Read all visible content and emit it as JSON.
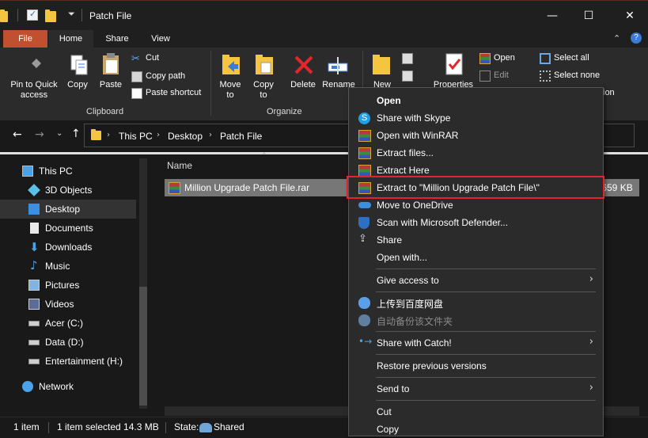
{
  "window": {
    "title": "Patch File",
    "minimize_icon": "minimize-icon",
    "maximize_icon": "maximize-icon",
    "close_icon": "close-icon",
    "min_glyph": "—",
    "max_glyph": "☐",
    "close_glyph": "✕"
  },
  "tabs": {
    "file": "File",
    "home": "Home",
    "share": "Share",
    "view": "View"
  },
  "ribbon": {
    "pin_label_1": "Pin to Quick",
    "pin_label_2": "access",
    "copy": "Copy",
    "paste": "Paste",
    "cut": "Cut",
    "copy_path": "Copy path",
    "paste_shortcut": "Paste shortcut",
    "clipboard_group": "Clipboard",
    "move_to": "Move",
    "move_to_2": "to",
    "copy_to": "Copy",
    "copy_to_2": "to",
    "delete": "Delete",
    "rename": "Rename",
    "organize_group": "Organize",
    "new": "New",
    "properties": "Properties",
    "open": "Open",
    "edit": "Edit",
    "select_all": "Select all",
    "select_none": "Select none",
    "invert_fragment": "ion"
  },
  "address": {
    "crumbs": [
      "This PC",
      "Desktop",
      "Patch File"
    ]
  },
  "nav": {
    "items": [
      {
        "label": "This PC",
        "icon": "pc-icon"
      },
      {
        "label": "3D Objects",
        "icon": "cube-icon"
      },
      {
        "label": "Desktop",
        "icon": "desktop-icon"
      },
      {
        "label": "Documents",
        "icon": "documents-icon"
      },
      {
        "label": "Downloads",
        "icon": "download-icon"
      },
      {
        "label": "Music",
        "icon": "music-icon"
      },
      {
        "label": "Pictures",
        "icon": "pictures-icon"
      },
      {
        "label": "Videos",
        "icon": "videos-icon"
      },
      {
        "label": "Acer (C:)",
        "icon": "drive-icon"
      },
      {
        "label": "Data (D:)",
        "icon": "drive-icon"
      },
      {
        "label": "Entertainment (H:)",
        "icon": "drive-icon"
      },
      {
        "label": "Network",
        "icon": "network-icon"
      }
    ]
  },
  "content": {
    "column_name": "Name",
    "file_name": "Million Upgrade Patch File.rar",
    "file_size": ",659 KB"
  },
  "status": {
    "item_count": "1 item",
    "selected": "1 item selected  14.3 MB",
    "state": "State:",
    "shared": "Shared"
  },
  "context_menu": {
    "items": [
      {
        "label": "Open",
        "icon": "none",
        "bold": true
      },
      {
        "label": "Share with Skype",
        "icon": "skype-icon"
      },
      {
        "label": "Open with WinRAR",
        "icon": "winrar-icon"
      },
      {
        "label": "Extract files...",
        "icon": "winrar-icon"
      },
      {
        "label": "Extract Here",
        "icon": "winrar-icon"
      },
      {
        "label": "Extract to \"Million Upgrade Patch File\\\"",
        "icon": "winrar-icon",
        "highlighted": true
      },
      {
        "label": "Move to OneDrive",
        "icon": "onedrive-icon"
      },
      {
        "label": "Scan with Microsoft Defender...",
        "icon": "defender-icon"
      },
      {
        "label": "Share",
        "icon": "share-icon"
      },
      {
        "label": "Open with...",
        "icon": "none"
      },
      {
        "label": "Give access to",
        "icon": "none",
        "submenu": true
      },
      {
        "label": "上传到百度网盘",
        "icon": "baidu-icon"
      },
      {
        "label": "自动备份该文件夹",
        "icon": "baidu-icon",
        "disabled": true
      },
      {
        "label": "Share with Catch!",
        "icon": "catch-icon",
        "submenu": true
      },
      {
        "label": "Restore previous versions",
        "icon": "none"
      },
      {
        "label": "Send to",
        "icon": "none",
        "submenu": true
      },
      {
        "label": "Cut",
        "icon": "none"
      },
      {
        "label": "Copy",
        "icon": "none"
      }
    ],
    "submenu_glyph": "›"
  },
  "colors": {
    "file_tab": "#c0502f",
    "highlight_border": "#e0262b",
    "selection": "#777777"
  }
}
